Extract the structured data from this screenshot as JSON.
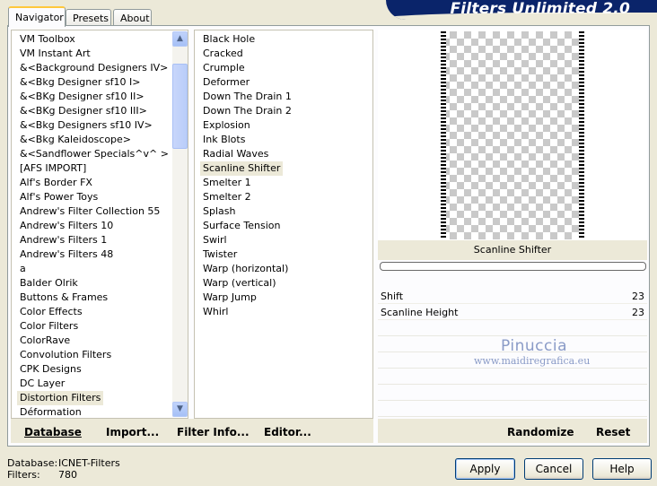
{
  "app": {
    "banner": "Filters Unlimited 2.0"
  },
  "tabs": [
    {
      "label": "Navigator"
    },
    {
      "label": "Presets"
    },
    {
      "label": "About"
    }
  ],
  "categories": [
    "VM Toolbox",
    "VM Instant Art",
    "&<Background Designers IV>",
    "&<Bkg Designer sf10 I>",
    "&<BKg Designer sf10 II>",
    "&<BKg Designer sf10 III>",
    "&<Bkg Designers sf10 IV>",
    "&<Bkg Kaleidoscope>",
    "&<Sandflower Specials^v^ >",
    "[AFS IMPORT]",
    "Alf's Border FX",
    "Alf's Power Toys",
    "Andrew's Filter Collection 55",
    "Andrew's Filters 10",
    "Andrew's Filters 1",
    "Andrew's Filters 48",
    "a",
    "Balder Olrik",
    "Buttons & Frames",
    "Color Effects",
    "Color Filters",
    "ColorRave",
    "Convolution Filters",
    "CPK Designs",
    "DC Layer",
    "Distortion Filters",
    "Déformation"
  ],
  "filters": [
    "Black Hole",
    "Cracked",
    "Crumple",
    "Deformer",
    "Down The Drain 1",
    "Down The Drain 2",
    "Explosion",
    "Ink Blots",
    "Radial Waves",
    "Scanline Shifter",
    "Smelter 1",
    "Smelter 2",
    "Splash",
    "Surface Tension",
    "Swirl",
    "Twister",
    "Warp (horizontal)",
    "Warp (vertical)",
    "Warp Jump",
    "Whirl"
  ],
  "selected_category": "Distortion Filters",
  "selected_filter": "Scanline Shifter",
  "preview": {
    "filter_name": "Scanline Shifter"
  },
  "params": [
    {
      "label": "Shift",
      "value": "23"
    },
    {
      "label": "Scanline Height",
      "value": "23"
    }
  ],
  "watermark": {
    "line1": "Pinuccia",
    "line2": "www.maidiregrafica.eu"
  },
  "toolbar": {
    "database": "Database",
    "import": "Import...",
    "filter_info": "Filter Info...",
    "editor": "Editor...",
    "randomize": "Randomize",
    "reset": "Reset"
  },
  "buttons": {
    "apply": "Apply",
    "cancel": "Cancel",
    "help": "Help"
  },
  "status": {
    "database_label": "Database:",
    "database_value": "ICNET-Filters",
    "filters_label": "Filters:",
    "filters_value": "780"
  }
}
